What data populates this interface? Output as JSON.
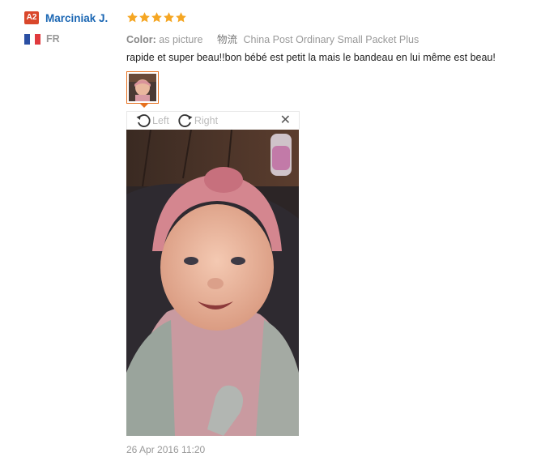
{
  "user": {
    "level_badge": "A2",
    "name": "Marciniak J.",
    "country_code": "FR",
    "flag_colors": [
      "#2a4fa3",
      "#ffffff",
      "#e03a3e"
    ]
  },
  "review": {
    "rating": 5,
    "star_color": "#f5a623",
    "color_label": "Color:",
    "color_value": "as picture",
    "shipping_label": "物流",
    "shipping_value": "China Post Ordinary Small Packet Plus",
    "text": "rapide et super beau!!bon bébé est petit la mais le bandeau en lui même est beau!",
    "timestamp": "26 Apr 2016 11:20"
  },
  "viewer": {
    "rotate_left_label": "Left",
    "rotate_right_label": "Right",
    "close_icon": "close-icon",
    "accent_color": "#e6701d"
  }
}
